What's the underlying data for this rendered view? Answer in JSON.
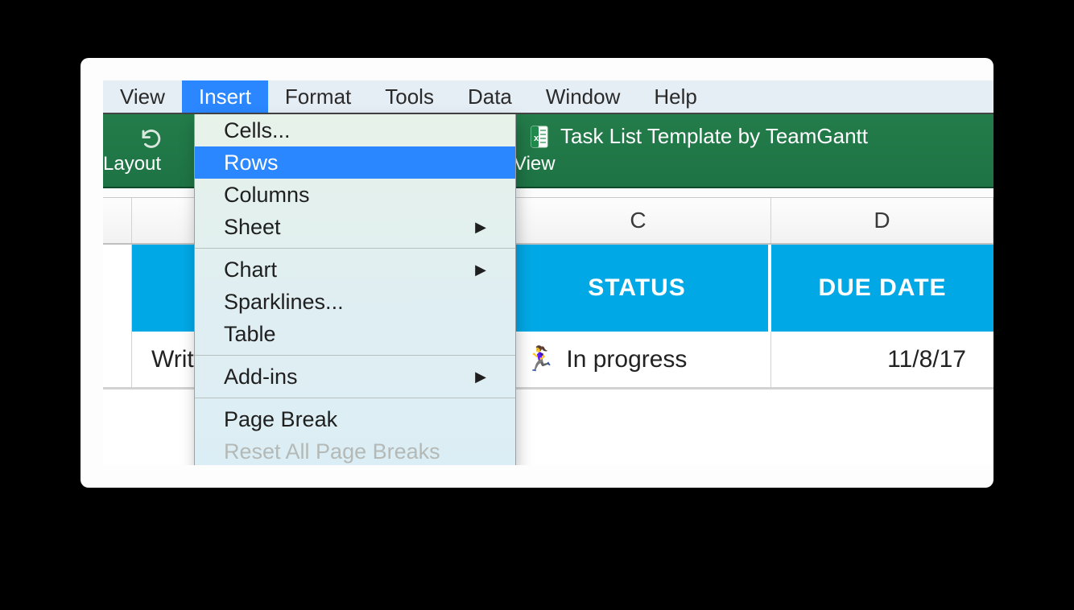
{
  "menubar": {
    "items": [
      "View",
      "Insert",
      "Format",
      "Tools",
      "Data",
      "Window",
      "Help"
    ],
    "active_index": 1
  },
  "ribbon": {
    "doc_title": "Task List Template by TeamGantt",
    "tab_layout": "Layout",
    "tab_view": "View"
  },
  "dropdown": {
    "group1": [
      {
        "label": "Cells...",
        "submenu": false
      },
      {
        "label": "Rows",
        "submenu": false,
        "highlight": true
      },
      {
        "label": "Columns",
        "submenu": false
      },
      {
        "label": "Sheet",
        "submenu": true
      }
    ],
    "group2": [
      {
        "label": "Chart",
        "submenu": true
      },
      {
        "label": "Sparklines...",
        "submenu": false
      },
      {
        "label": "Table",
        "submenu": false
      }
    ],
    "group3": [
      {
        "label": "Add-ins",
        "submenu": true
      }
    ],
    "group4": [
      {
        "label": "Page Break",
        "submenu": false
      },
      {
        "label": "Reset All Page Breaks",
        "submenu": false,
        "disabled": true
      }
    ]
  },
  "columns": {
    "c": "C",
    "d": "D"
  },
  "sheet_header": {
    "status": "STATUS",
    "due_date": "DUE DATE"
  },
  "row1": {
    "task_partial": "Write",
    "status_text": "In progress",
    "status_emoji": "🏃‍♀️",
    "due_date": "11/8/17"
  }
}
